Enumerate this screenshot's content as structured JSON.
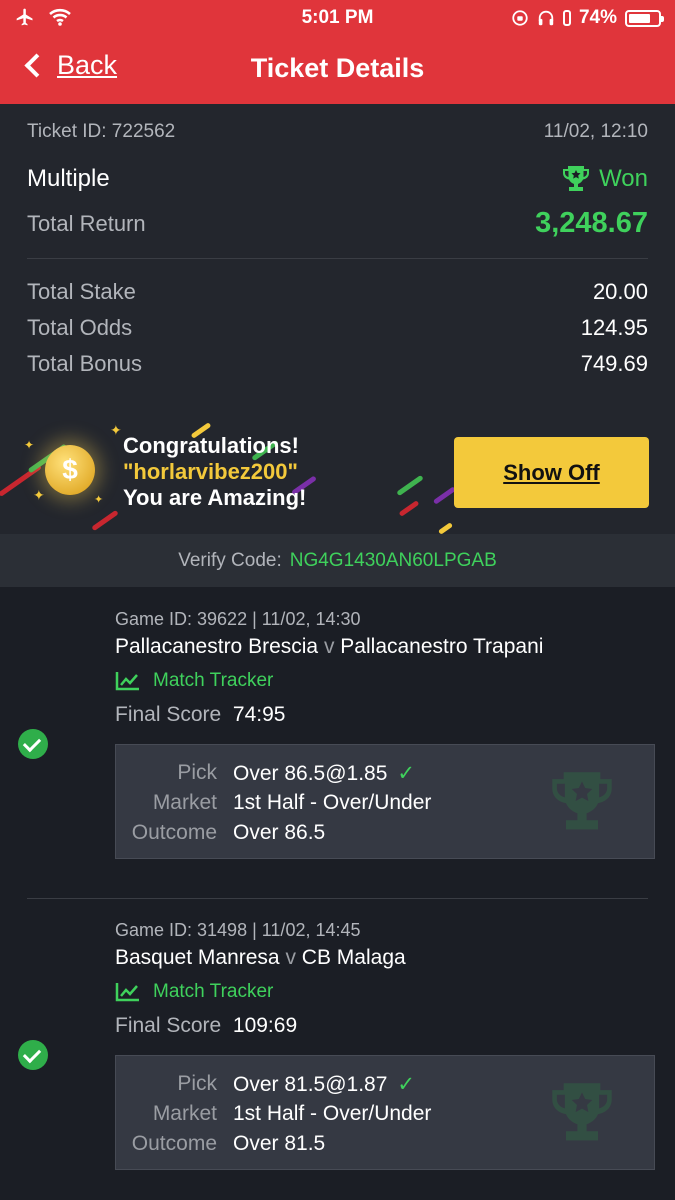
{
  "status_bar": {
    "time": "5:01 PM",
    "battery": "74%",
    "battery_level": 0.74
  },
  "nav": {
    "back_label": "Back",
    "title": "Ticket Details"
  },
  "ticket": {
    "id_label": "Ticket ID: 722562",
    "datetime": "11/02, 12:10",
    "type": "Multiple",
    "status": "Won",
    "total_return_label": "Total Return",
    "total_return": "3,248.67",
    "total_stake_label": "Total Stake",
    "total_stake": "20.00",
    "total_odds_label": "Total Odds",
    "total_odds": "124.95",
    "total_bonus_label": "Total Bonus",
    "total_bonus": "749.69"
  },
  "banner": {
    "line1": "Congratulations!",
    "line2": "\"horlarvibez200\"",
    "line3": "You are Amazing!",
    "button": "Show Off",
    "coin_glyph": "$"
  },
  "verify": {
    "label": "Verify Code:",
    "code": "NG4G1430AN60LPGAB"
  },
  "games": [
    {
      "game_id": "Game ID: 39622 | 11/02, 14:30",
      "home": "Pallacanestro Brescia",
      "vs": "v",
      "away": "Pallacanestro Trapani",
      "tracker": "Match Tracker",
      "final_score_label": "Final Score",
      "final_score": "74:95",
      "pick_label": "Pick",
      "pick": "Over 86.5@1.85",
      "market_label": "Market",
      "market": "1st Half - Over/Under",
      "outcome_label": "Outcome",
      "outcome": "Over 86.5"
    },
    {
      "game_id": "Game ID: 31498 | 11/02, 14:45",
      "home": "Basquet Manresa",
      "vs": "v",
      "away": "CB Malaga",
      "tracker": "Match Tracker",
      "final_score_label": "Final Score",
      "final_score": "109:69",
      "pick_label": "Pick",
      "pick": "Over 81.5@1.87",
      "market_label": "Market",
      "market": "1st Half - Over/Under",
      "outcome_label": "Outcome",
      "outcome": "Over 81.5"
    }
  ]
}
